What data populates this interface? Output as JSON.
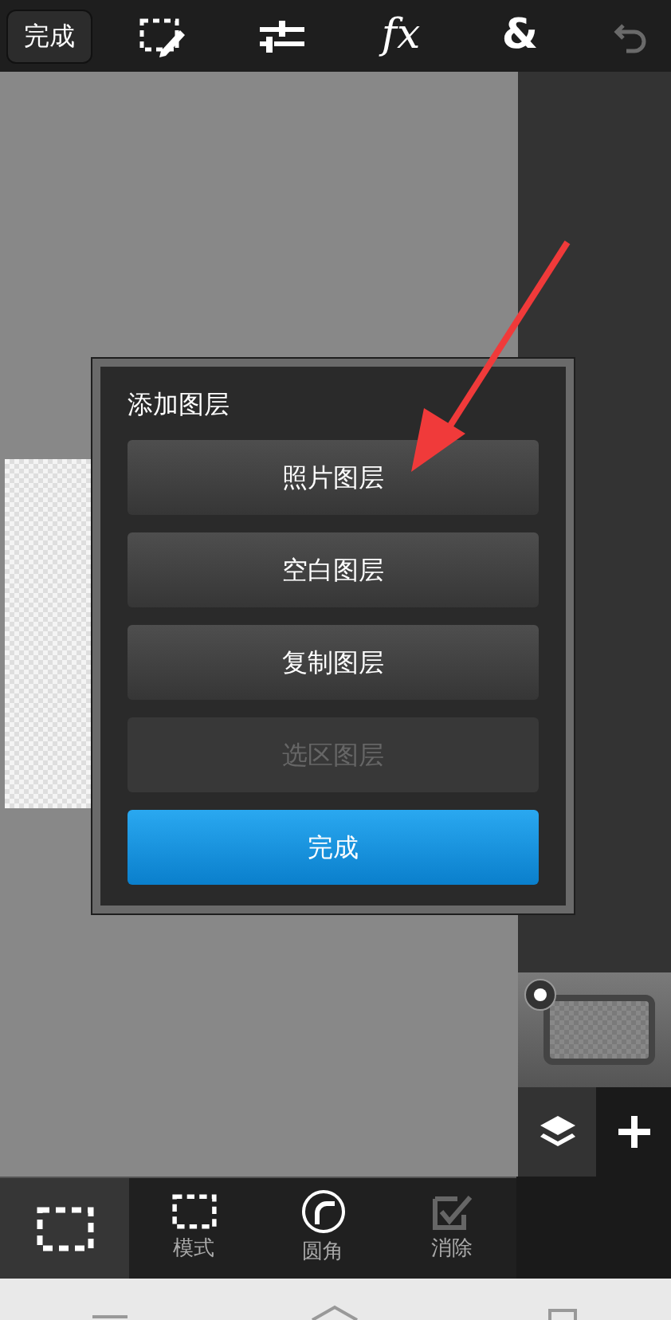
{
  "top_bar": {
    "done_button": "完成",
    "tools": [
      {
        "kind": "select-edit"
      },
      {
        "kind": "adjust"
      },
      {
        "kind": "fx",
        "label": "fx"
      },
      {
        "kind": "ampersand",
        "label": "&"
      },
      {
        "kind": "undo",
        "disabled": true
      }
    ]
  },
  "dialog": {
    "title": "添加图层",
    "options": [
      {
        "label": "照片图层",
        "disabled": false
      },
      {
        "label": "空白图层",
        "disabled": false
      },
      {
        "label": "复制图层",
        "disabled": false
      },
      {
        "label": "选区图层",
        "disabled": true
      }
    ],
    "confirm": "完成"
  },
  "bottom_toolbar": [
    {
      "kind": "select",
      "selected": true
    },
    {
      "kind": "mode",
      "label": "模式",
      "selected": false
    },
    {
      "kind": "round",
      "label": "圆角",
      "selected": false
    },
    {
      "kind": "antialias",
      "label": "消除",
      "selected": false
    }
  ]
}
